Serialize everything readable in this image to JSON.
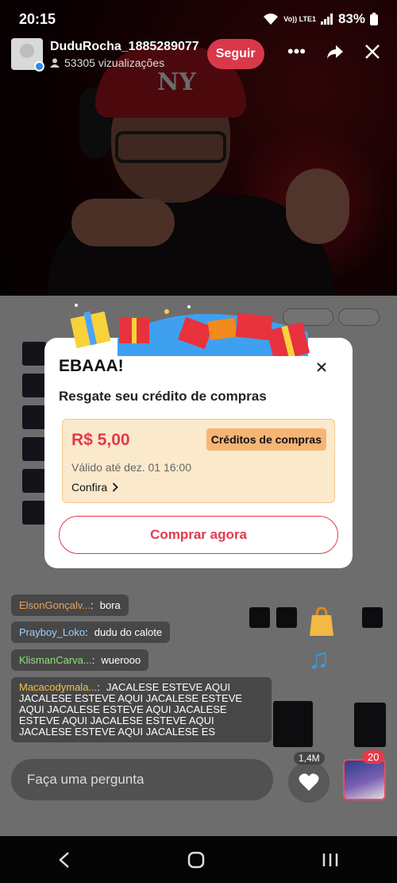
{
  "status_bar": {
    "time": "20:15",
    "network": "Vo)) LTE1",
    "battery": "83%"
  },
  "live": {
    "host_name": "DuduRocha_1885289077",
    "views": "53305 vizualizações",
    "follow_label": "Seguir"
  },
  "chat": [
    {
      "user": "ElsonGonçalv...",
      "message": "bora",
      "color": "#e9a15a"
    },
    {
      "user": "Prayboy_Loko",
      "message": "dudu do calote",
      "color": "#9dd0ff"
    },
    {
      "user": "KlismanCarva...",
      "message": "wuerooo",
      "color": "#8fe07a"
    },
    {
      "user": "Macacodymala...",
      "message": "JACALESE ESTEVE AQUI JACALESE ESTEVE AQUI JACALESE ESTEVE AQUI JACALESE ESTEVE AQUI JACALESE ESTEVE AQUI JACALESE ESTEVE AQUI JACALESE ESTEVE AQUI JACALESE ES",
      "color": "#f2c14e"
    }
  ],
  "ask_placeholder": "Faça uma pergunta",
  "like_count": "1,4M",
  "cart_count": "20",
  "modal": {
    "title": "EBAAA!",
    "subtitle": "Resgate seu crédito de compras",
    "coupon_amount": "R$ 5,00",
    "coupon_tag": "Créditos de compras",
    "valid_until": "Válido até dez. 01 16:00",
    "details_link": "Confira",
    "buy_label": "Comprar agora"
  },
  "icons": [
    "more-icon",
    "share-icon",
    "close-icon",
    "heart-icon",
    "back-icon",
    "home-icon",
    "recents-icon",
    "chevron-right-icon",
    "user-icon"
  ],
  "colors": {
    "accent": "#e23a4c",
    "follow": "#d9384a",
    "coupon_bg": "#fbe9cc",
    "tag_bg": "#f6b574"
  }
}
